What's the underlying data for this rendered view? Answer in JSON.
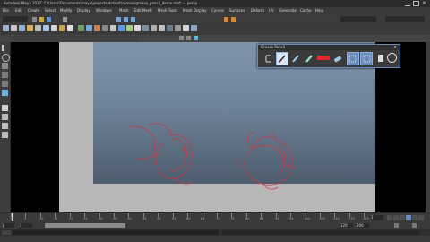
{
  "window": {
    "title": "Autodesk Maya 2017: C:\\Users\\Documents\\maya\\projects\\default\\scenes\\grease_pencil_demo.mb* --- persp"
  },
  "menubar": {
    "items": [
      "File",
      "Edit",
      "Create",
      "Select",
      "Modify",
      "Display",
      "Windows",
      "Mesh",
      "Edit Mesh",
      "Mesh Tools",
      "Mesh Display",
      "Curves",
      "Surfaces",
      "Deform",
      "UV",
      "Generate",
      "Cache",
      "Help"
    ]
  },
  "grease_pencil": {
    "title": "Grease Pencil",
    "tools": [
      {
        "name": "add-frame-icon"
      },
      {
        "name": "pencil-icon"
      },
      {
        "name": "marker-icon"
      },
      {
        "name": "soft-pencil-icon"
      },
      {
        "name": "color-swatch-icon"
      },
      {
        "name": "eraser-icon"
      },
      {
        "name": "ghost-previous-icon"
      },
      {
        "name": "ghost-next-icon"
      },
      {
        "name": "export-icon"
      },
      {
        "name": "import-icon"
      },
      {
        "name": "settings-icon"
      }
    ],
    "stroke_color": "#e8232b",
    "selected_tool": "pencil-icon"
  },
  "viewport": {
    "camera_label": "persp"
  },
  "timeslider": {
    "current_frame": "1",
    "ticks": [
      "1",
      "5",
      "10",
      "15",
      "20",
      "25",
      "30",
      "35",
      "40",
      "45",
      "50",
      "55",
      "60",
      "65",
      "70",
      "75",
      "80",
      "85",
      "90",
      "95",
      "100",
      "105",
      "110",
      "115",
      "120"
    ]
  },
  "range": {
    "start": "1",
    "end": "120",
    "anim_start": "1",
    "anim_end": "200"
  },
  "colors": {
    "accent": "#6a8bbd",
    "sketch": "#d9303a"
  }
}
